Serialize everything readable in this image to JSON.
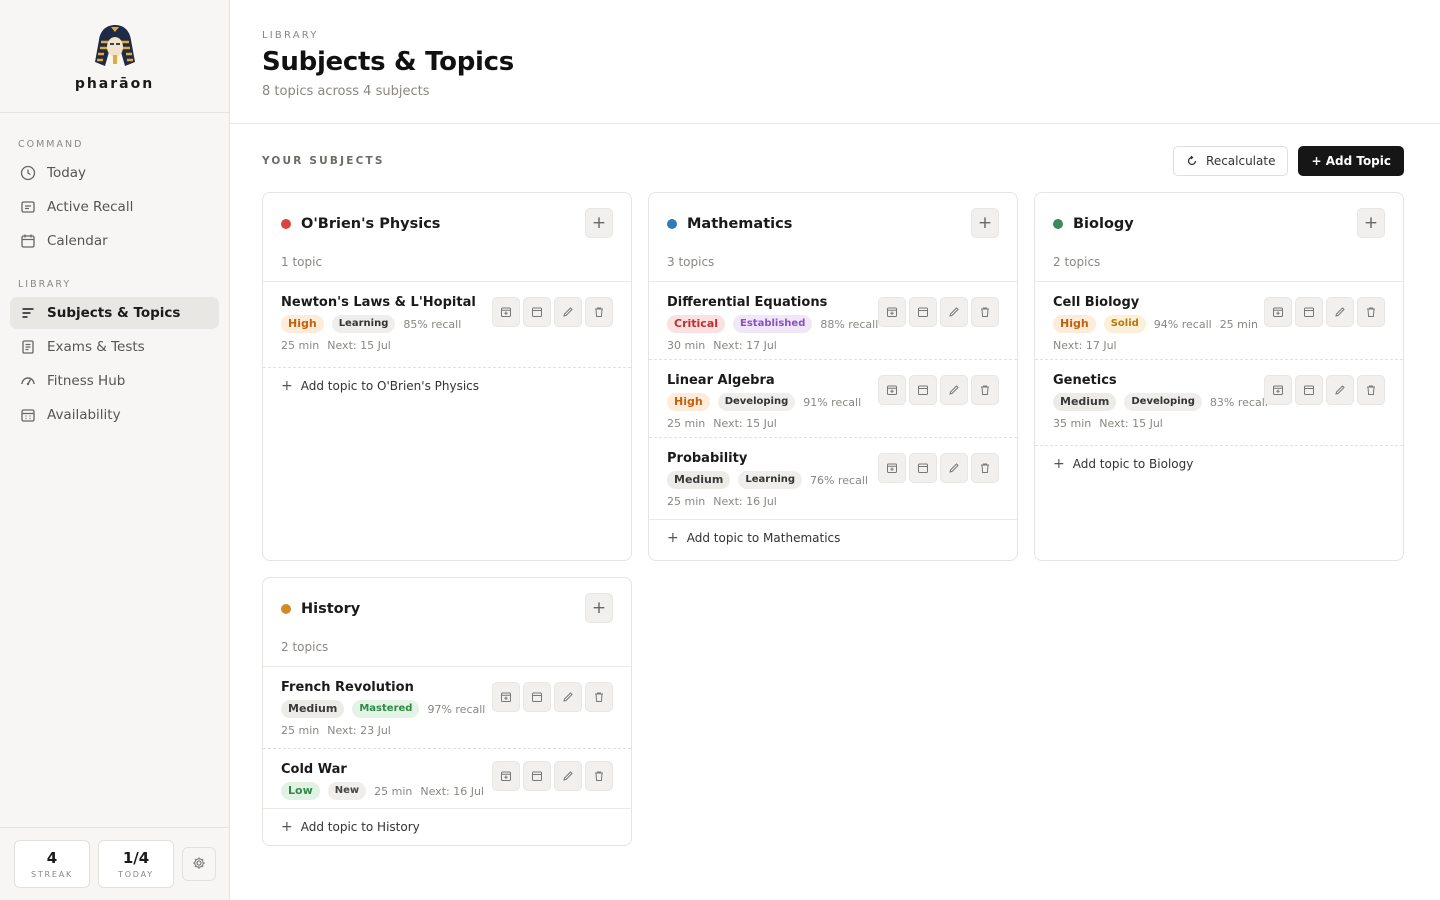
{
  "brand": {
    "name": "pharāon"
  },
  "nav": {
    "command_heading": "COMMAND",
    "command_items": [
      {
        "label": "Today",
        "icon": "clock-icon"
      },
      {
        "label": "Active Recall",
        "icon": "card-icon"
      },
      {
        "label": "Calendar",
        "icon": "calendar-icon"
      }
    ],
    "library_heading": "LIBRARY",
    "library_items": [
      {
        "label": "Subjects & Topics",
        "icon": "list-icon",
        "active": true
      },
      {
        "label": "Exams & Tests",
        "icon": "document-icon"
      },
      {
        "label": "Fitness Hub",
        "icon": "gauge-icon"
      },
      {
        "label": "Availability",
        "icon": "calendar-grid-icon"
      }
    ]
  },
  "footer": {
    "streak": {
      "value": "4",
      "label": "STREAK"
    },
    "today": {
      "value": "1/4",
      "label": "TODAY"
    }
  },
  "header": {
    "eyebrow": "LIBRARY",
    "title": "Subjects & Topics",
    "subtitle": "8 topics across 4 subjects"
  },
  "toolbar": {
    "section_label": "YOUR SUBJECTS",
    "recalculate_label": "Recalculate",
    "add_topic_label": "+ Add Topic"
  },
  "colors": {
    "physics": "#d9463e",
    "mathematics": "#2f7bb8",
    "biology": "#3b8a5a",
    "history": "#d08a2a"
  },
  "subjects": [
    {
      "name": "O'Brien's Physics",
      "count": "1 topic",
      "add_label": "Add topic to O'Brien's Physics",
      "topics": [
        {
          "name": "Newton's Laws & L'Hopital",
          "priority": "High",
          "stage": "Learning",
          "recall": "85% recall",
          "duration": "25 min",
          "next": "Next: 15 Jul"
        }
      ]
    },
    {
      "name": "Mathematics",
      "count": "3 topics",
      "add_label": "Add topic to Mathematics",
      "topics": [
        {
          "name": "Differential Equations",
          "priority": "Critical",
          "stage": "Established",
          "recall": "88% recall",
          "duration": "30 min",
          "next": "Next: 17 Jul"
        },
        {
          "name": "Linear Algebra",
          "priority": "High",
          "stage": "Developing",
          "recall": "91% recall",
          "duration": "25 min",
          "next": "Next: 15 Jul"
        },
        {
          "name": "Probability",
          "priority": "Medium",
          "stage": "Learning",
          "recall": "76% recall",
          "duration": "25 min",
          "next": "Next: 16 Jul"
        }
      ]
    },
    {
      "name": "Biology",
      "count": "2 topics",
      "add_label": "Add topic to Biology",
      "topics": [
        {
          "name": "Cell Biology",
          "priority": "High",
          "stage": "Solid",
          "recall": "94% recall",
          "duration": "25 min",
          "next": "Next: 17 Jul"
        },
        {
          "name": "Genetics",
          "priority": "Medium",
          "stage": "Developing",
          "recall": "83% recall",
          "duration": "35 min",
          "next": "Next: 15 Jul"
        }
      ]
    },
    {
      "name": "History",
      "count": "2 topics",
      "add_label": "Add topic to History",
      "topics": [
        {
          "name": "French Revolution",
          "priority": "Medium",
          "stage": "Mastered",
          "recall": "97% recall",
          "duration": "25 min",
          "next": "Next: 23 Jul"
        },
        {
          "name": "Cold War",
          "priority": "Low",
          "stage": "New",
          "duration": "25 min",
          "next": "Next: 16 Jul"
        }
      ]
    }
  ]
}
